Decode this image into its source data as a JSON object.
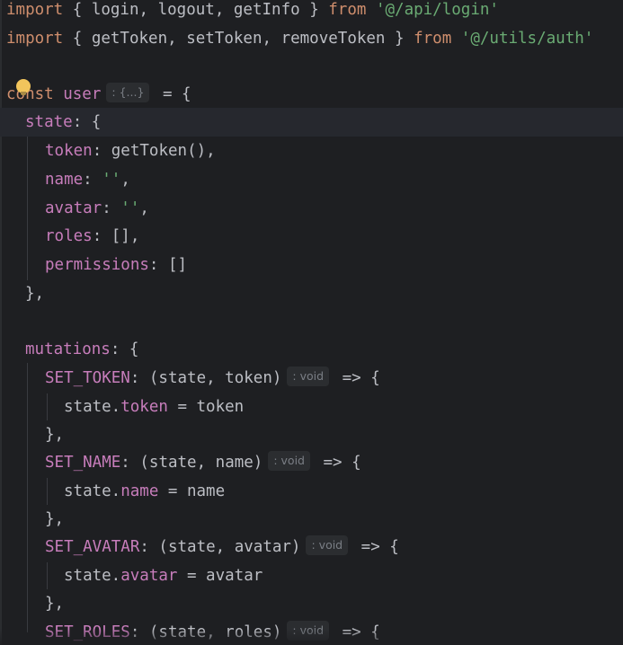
{
  "editor": {
    "line1": {
      "kw_import": "import",
      "open": " { ",
      "fn_login": "login",
      "c1": ", ",
      "fn_logout": "logout",
      "c2": ", ",
      "fn_getInfo": "getInfo",
      "close": " } ",
      "kw_from": "from",
      "sp": " ",
      "path": "'@/api/login'"
    },
    "line2": {
      "kw_import": "import",
      "open": " { ",
      "fn_getToken": "getToken",
      "c1": ", ",
      "fn_setToken": "setToken",
      "c2": ", ",
      "fn_removeToken": "removeToken",
      "close": " } ",
      "kw_from": "from",
      "sp": " ",
      "path": "'@/utils/auth'"
    },
    "line4": {
      "kw_const": "const",
      "sp": " ",
      "name": "user",
      "hint": ": {...}",
      "rest": " = {"
    },
    "line5": {
      "prop": "state",
      "rest": ": {"
    },
    "line6": {
      "prop": "token",
      "colon": ": ",
      "fn": "getToken",
      "rest": "(),"
    },
    "line7": {
      "prop": "name",
      "colon": ": ",
      "str": "''",
      "rest": ","
    },
    "line8": {
      "prop": "avatar",
      "colon": ": ",
      "str": "''",
      "rest": ","
    },
    "line9": {
      "prop": "roles",
      "rest": ": [],"
    },
    "line10": {
      "prop": "permissions",
      "rest": ": []"
    },
    "line11": {
      "text": "},"
    },
    "line13": {
      "prop": "mutations",
      "rest": ": {"
    },
    "line14": {
      "prop": "SET_TOKEN",
      "params": ": (state, token)",
      "hint": ": void",
      "arrow": " => {"
    },
    "line15": {
      "obj": "state.",
      "prop": "token",
      "rest": " = token"
    },
    "line16": {
      "text": "},"
    },
    "line17": {
      "prop": "SET_NAME",
      "params": ": (state, name)",
      "hint": ": void",
      "arrow": " => {"
    },
    "line18": {
      "obj": "state.",
      "prop": "name",
      "rest": " = name"
    },
    "line19": {
      "text": "},"
    },
    "line20": {
      "prop": "SET_AVATAR",
      "params": ": (state, avatar)",
      "hint": ": void",
      "arrow": " => {"
    },
    "line21": {
      "obj": "state.",
      "prop": "avatar",
      "rest": " = avatar"
    },
    "line22": {
      "text": "},"
    },
    "line23": {
      "prop": "SET_ROLES",
      "params": ": (state, roles)",
      "hint": ": void",
      "arrow": " => {"
    }
  },
  "icons": {
    "intention_bulb": "lightbulb-icon"
  },
  "colors": {
    "background": "#1e1f22",
    "keyword": "#cf8e6d",
    "property": "#c77dbb",
    "string": "#6aab73",
    "function": "#56a8f5",
    "text": "#bcbec4",
    "hint_bg": "#2b2d30",
    "hint_text": "#7a7e85",
    "caret_line": "#26282e"
  }
}
